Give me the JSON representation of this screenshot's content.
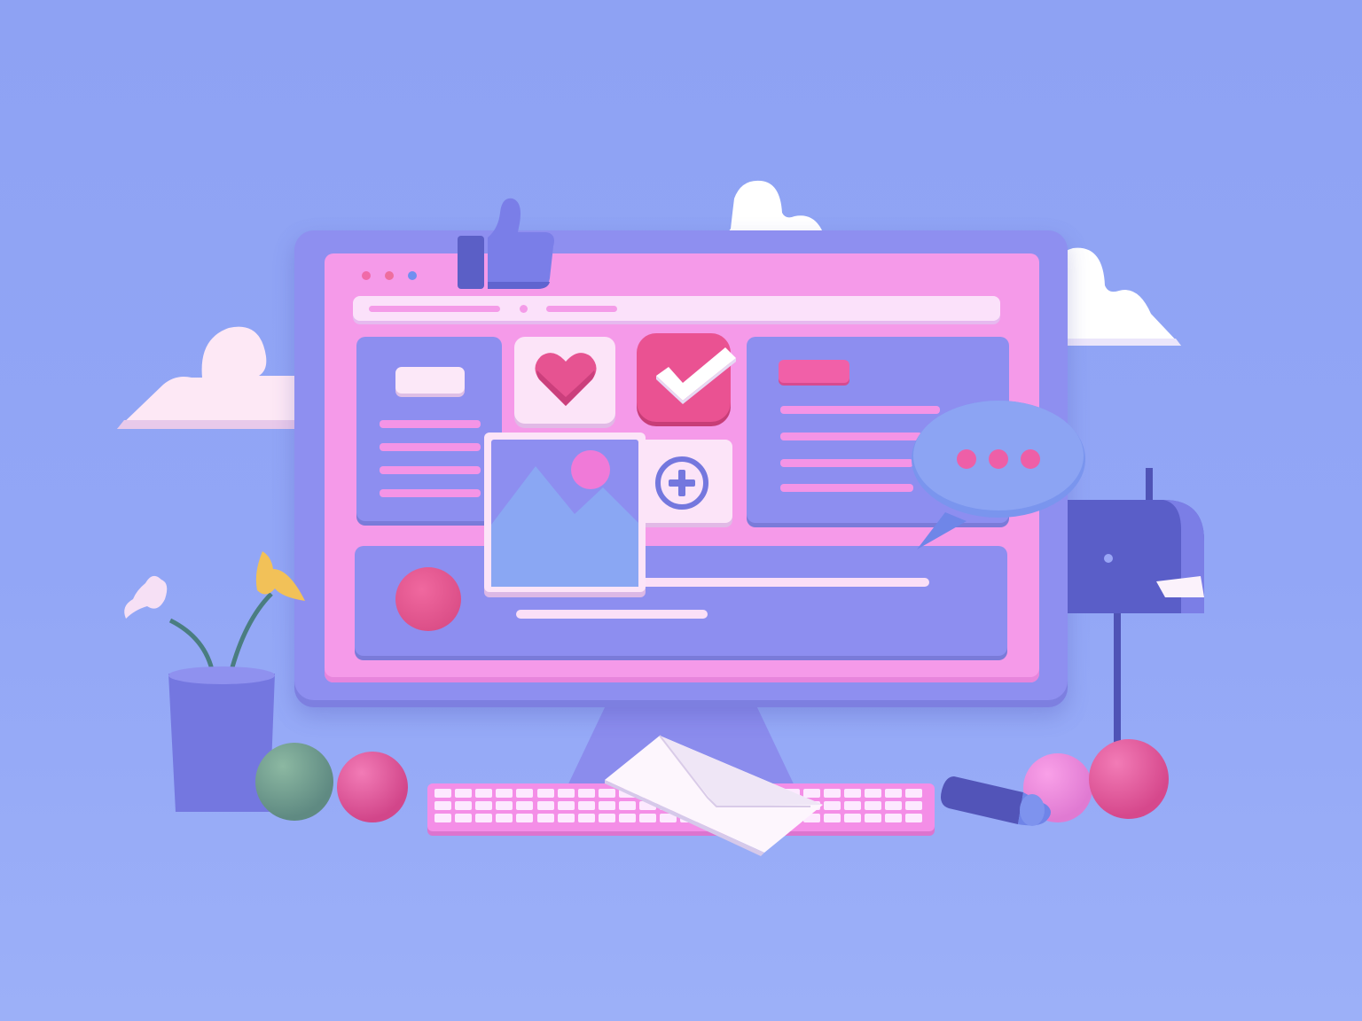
{
  "scene": {
    "subject": "",
    "colors": {
      "background": "#8ea2f3",
      "monitor": "#8e8ff0",
      "screen": "#f59ae9",
      "accent_pink": "#e9528f",
      "light_panel": "#fbe1fa",
      "cloud": "#ffffff"
    },
    "icons": [
      "thumbs-up-icon",
      "heart-icon",
      "checkmark-icon",
      "image-icon",
      "plus-icon",
      "chat-bubble-icon",
      "mailbox-icon",
      "envelope-icon",
      "cloud-icon",
      "flower-pot-icon",
      "keyboard-icon",
      "pencil-icon"
    ]
  }
}
